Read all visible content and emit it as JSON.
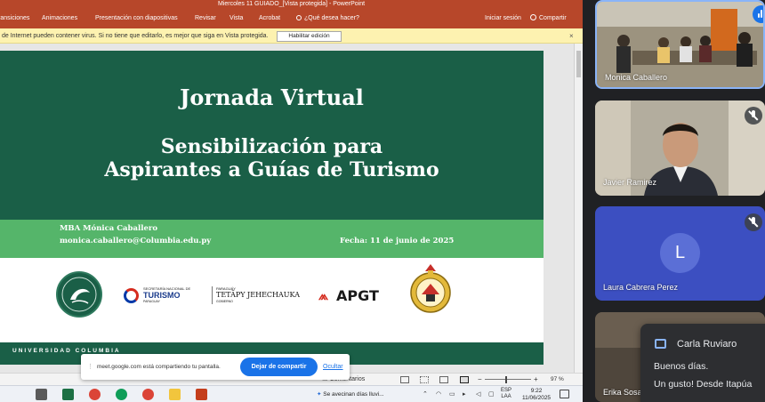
{
  "powerpoint": {
    "window_title": "Miercoles 11 GUIADO_[Vista protegida] - PowerPoint",
    "ribbon_tabs": [
      "Transiciones",
      "Animaciones",
      "Presentación con diapositivas",
      "Revisar",
      "Vista",
      "Acrobat"
    ],
    "tell_me": "¿Qué desea hacer?",
    "sign_in": "Iniciar sesión",
    "share": "Compartir",
    "protected_view": {
      "message": "de Internet pueden contener virus. Si no tiene que editarlo, es mejor que siga en Vista protegida.",
      "enable_editing": "Habilitar edición",
      "close": "×"
    },
    "slide": {
      "heading": "Jornada Virtual",
      "title_line1": "Sensibilización para",
      "title_line2": "Aspirantes a Guías de Turismo",
      "presenter": "MBA Mónica Caballero",
      "email": "monica.caballero@Columbia.edu.py",
      "date": "Fecha:  11 de junio de 2025",
      "logo_sen_small": "SECRETARÍA NACIONAL DE",
      "logo_sen_big": "TURISMO",
      "logo_sen_country": "PARAGUAY",
      "logo_tetapy_small": "PARAGUÁY",
      "logo_tetapy_big": "TETÃPY JEHECHAUKA",
      "logo_tetapy_sub": "GOBIERNO",
      "logo_apgt": "APGT",
      "university": "UNIVERSIDAD COLUMBIA"
    },
    "status": {
      "comments": "Comentarios",
      "zoom": "97 %"
    }
  },
  "meet_share_bar": {
    "text": "meet.google.com está compartiendo tu pantalla.",
    "stop": "Dejar de compartir",
    "hide": "Ocultar"
  },
  "taskbar": {
    "weather": "Se avecinan días lluvi...",
    "lang_line1": "ESP",
    "lang_line2": "LAA",
    "time": "9:22",
    "date": "11/06/2025"
  },
  "meet": {
    "participants": [
      {
        "name": "Monica Caballero"
      },
      {
        "name": "Javier Ramirez"
      },
      {
        "name": "Laura Cabrera Perez",
        "initial": "L"
      },
      {
        "name": "Erika Sosa"
      }
    ],
    "chat": {
      "sender": "Carla Ruviaro",
      "line1": "Buenos días.",
      "line2": "Un gusto! Desde Itapúa"
    }
  },
  "colors": {
    "ppt_accent": "#b7472a",
    "slide_dark_green": "#1a5f47",
    "slide_light_green": "#55b56a",
    "meet_blue": "#1a73e8"
  }
}
